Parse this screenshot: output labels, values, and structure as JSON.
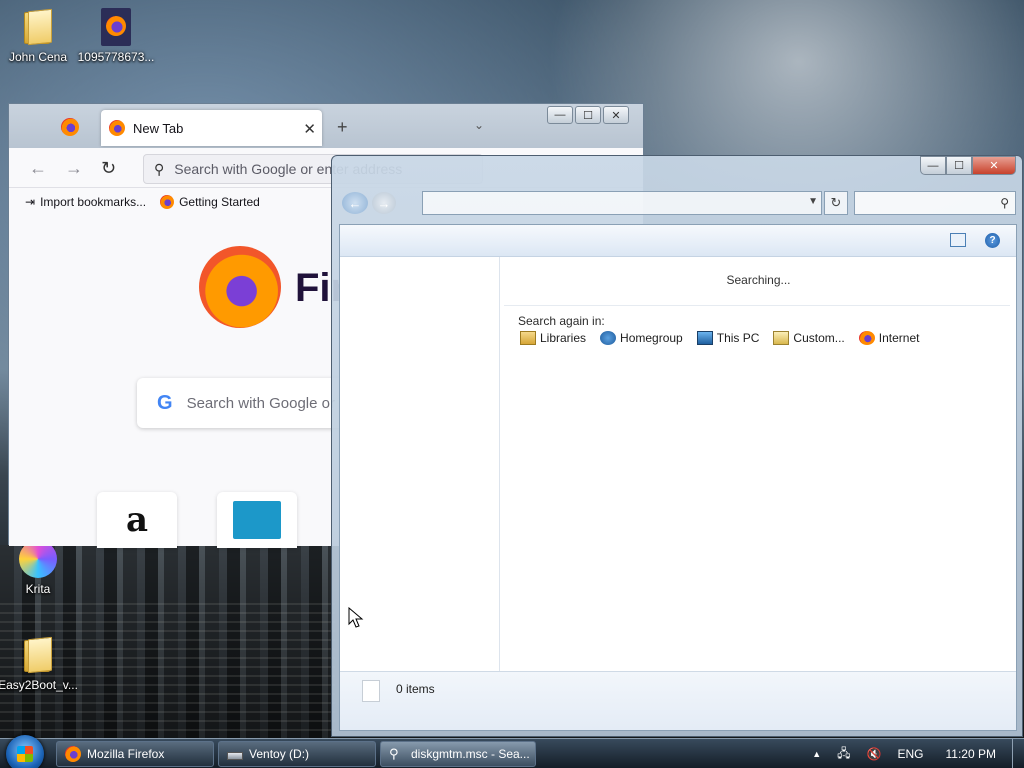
{
  "desktop": {
    "icons": [
      {
        "label": "John Cena",
        "icon": "user-folder-icon"
      },
      {
        "label": "1095778673...",
        "icon": "firefox-file-icon"
      },
      {
        "label": "Krita",
        "icon": "krita-icon"
      },
      {
        "label": "Easy2Boot_v...",
        "icon": "folder-icon"
      }
    ]
  },
  "firefox": {
    "tab_label": "New Tab",
    "tab_close": "✕",
    "new_tab": "+",
    "tab_list": "⌄",
    "urlbar_placeholder": "Search with Google or enter address",
    "bookmarks": [
      {
        "label": "Import bookmarks...",
        "icon": "import-icon"
      },
      {
        "label": "Getting Started",
        "icon": "firefox-icon"
      }
    ],
    "wordmark": "Firefox",
    "search_placeholder": "Search with Google or enter address",
    "google_letter": "G",
    "tiles": [
      {
        "label": "a",
        "icon": "amazon-icon"
      },
      {
        "label": "",
        "icon": "site-tile-icon"
      }
    ],
    "controls": {
      "minimize": "—",
      "maximize": "☐",
      "close": "✕"
    }
  },
  "explorer": {
    "status_searching": "Searching...",
    "search_again_label": "Search again in:",
    "search_again_items": [
      {
        "label": "Libraries",
        "icon": "libraries-icon"
      },
      {
        "label": "Homegroup",
        "icon": "homegroup-icon"
      },
      {
        "label": "This PC",
        "icon": "this-pc-icon"
      },
      {
        "label": "Custom...",
        "icon": "custom-folder-icon"
      },
      {
        "label": "Internet",
        "icon": "internet-icon"
      }
    ],
    "item_count": "0 items",
    "help": "?",
    "controls": {
      "minimize": "—",
      "maximize": "☐",
      "close": "✕"
    }
  },
  "taskbar": {
    "buttons": [
      {
        "label": "Mozilla Firefox",
        "icon": "firefox-icon"
      },
      {
        "label": "Ventoy (D:)",
        "icon": "drive-icon"
      },
      {
        "label": "diskgmtm.msc - Sea...",
        "icon": "search-icon"
      }
    ],
    "tray": {
      "language": "ENG",
      "time": "11:20 PM",
      "arrow": "▲"
    }
  }
}
